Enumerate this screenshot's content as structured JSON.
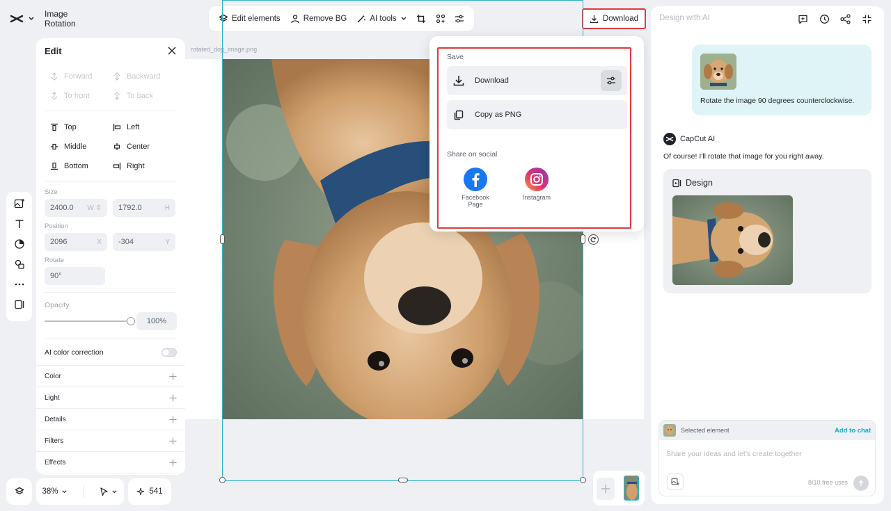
{
  "app": {
    "title": "Image Rotation"
  },
  "toolbar": {
    "edit_elements": "Edit elements",
    "remove_bg": "Remove BG",
    "ai_tools": "AI tools"
  },
  "download_button": {
    "label": "Download"
  },
  "edit_panel": {
    "title": "Edit",
    "order": {
      "forward": "Forward",
      "backward": "Backward",
      "to_front": "To front",
      "to_back": "To back"
    },
    "align": {
      "top": "Top",
      "left": "Left",
      "middle": "Middle",
      "center": "Center",
      "bottom": "Bottom",
      "right": "Right"
    },
    "size": {
      "label": "Size",
      "w": "2400.0",
      "w_unit": "W",
      "h": "1792.0",
      "h_unit": "H"
    },
    "position": {
      "label": "Position",
      "x": "2096",
      "x_unit": "X",
      "y": "-304",
      "y_unit": "Y"
    },
    "rotate": {
      "label": "Rotate",
      "value": "90°"
    },
    "opacity": {
      "label": "Opacity",
      "value": "100%",
      "level": 1.0
    },
    "ai_color": {
      "label": "AI color correction",
      "enabled": false
    },
    "sections": [
      "Color",
      "Light",
      "Details",
      "Filters",
      "Effects"
    ]
  },
  "bottom_bar": {
    "zoom": "38%",
    "credits": "541"
  },
  "canvas": {
    "filename": "rotated_dog_image.png"
  },
  "popup": {
    "save_label": "Save",
    "download": "Download",
    "copy_png": "Copy as PNG",
    "share_label": "Share on social",
    "facebook": "Facebook Page",
    "instagram": "Instagram"
  },
  "right_panel": {
    "title": "Design with AI",
    "user_message": "Rotate the image 90 degrees counterclockwise.",
    "ai_name": "CapCut AI",
    "ai_message": "Of course! I'll rotate that image for you right away.",
    "design_title": "Design",
    "selected_element": "Selected element",
    "add_to_chat": "Add to chat",
    "input_placeholder": "Share your ideas and let's create together",
    "free_uses": "8/10 free uses"
  },
  "colors": {
    "accent": "#2bb3c9",
    "highlight": "#e03a3a",
    "link": "#17a9c4"
  }
}
